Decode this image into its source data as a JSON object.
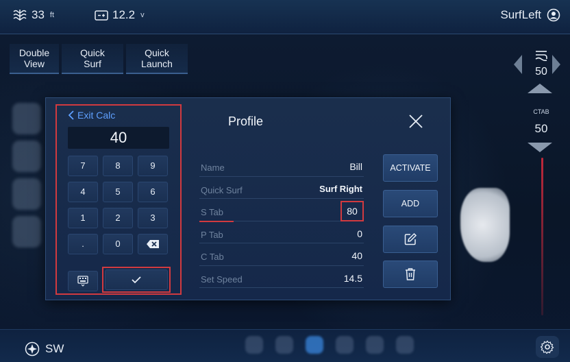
{
  "status": {
    "depth_value": "33",
    "depth_unit": "ft",
    "voltage_value": "12.2",
    "voltage_unit": "v",
    "profile_label": "SurfLeft"
  },
  "tabs": [
    {
      "line1": "Double",
      "line2": "View"
    },
    {
      "line1": "Quick",
      "line2": "Surf"
    },
    {
      "line1": "Quick",
      "line2": "Launch"
    }
  ],
  "wave": {
    "value": "50"
  },
  "ctab": {
    "label": "CTAB",
    "value": "50"
  },
  "calculator": {
    "exit_label": "Exit Calc",
    "display_value": "40",
    "keys": [
      "7",
      "8",
      "9",
      "4",
      "5",
      "6",
      "1",
      "2",
      "3",
      ".",
      "0",
      "backspace"
    ]
  },
  "profile": {
    "title": "Profile",
    "fields": [
      {
        "label": "Name",
        "value": "Bill"
      },
      {
        "label": "Quick Surf",
        "value": "Surf Right"
      },
      {
        "label": "S Tab",
        "value": "80"
      },
      {
        "label": "P Tab",
        "value": "0"
      },
      {
        "label": "C Tab",
        "value": "40"
      },
      {
        "label": "Set Speed",
        "value": "14.5"
      }
    ],
    "actions": {
      "activate": "ACTIVATE",
      "add": "ADD"
    }
  },
  "footer": {
    "heading": "SW"
  },
  "colors": {
    "accent": "#5fa0ff",
    "highlight": "#d23a3f",
    "panel": "#1a2e4c"
  }
}
